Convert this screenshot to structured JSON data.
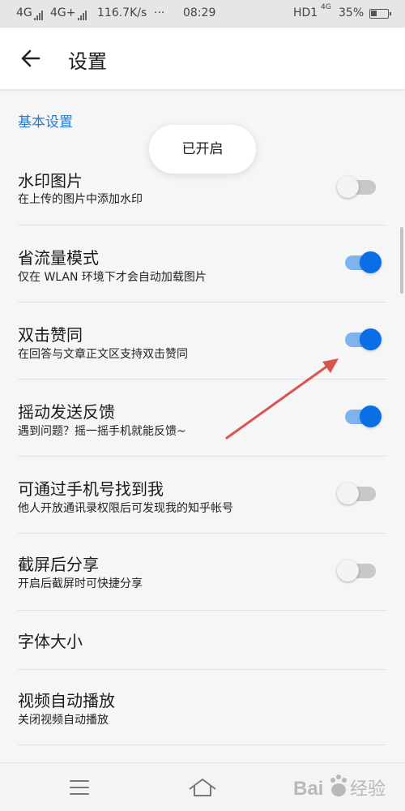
{
  "status_bar": {
    "network1": "4G",
    "network2": "4G+",
    "speed": "116.7K/s",
    "dots": "···",
    "time": "08:29",
    "hd": "HD1",
    "net_small": "4G",
    "battery": "35%"
  },
  "app_bar": {
    "title": "设置"
  },
  "section": {
    "basic": "基本设置"
  },
  "toast": "已开启",
  "settings": [
    {
      "title": "水印图片",
      "desc": "在上传的图片中添加水印",
      "on": false
    },
    {
      "title": "省流量模式",
      "desc": "仅在 WLAN 环境下才会自动加载图片",
      "on": true
    },
    {
      "title": "双击赞同",
      "desc": "在回答与文章正文区支持双击赞同",
      "on": true
    },
    {
      "title": "摇动发送反馈",
      "desc": "遇到问题？摇一摇手机就能反馈~",
      "on": true
    },
    {
      "title": "可通过手机号找到我",
      "desc": "他人开放通讯录权限后可发现我的知乎帐号",
      "on": false
    },
    {
      "title": "截屏后分享",
      "desc": "开启后截屏时可快捷分享",
      "on": false
    }
  ],
  "font_size": {
    "title": "字体大小"
  },
  "video": {
    "title": "视频自动播放",
    "desc": "关闭视频自动播放"
  },
  "colors": {
    "accent": "#1e7ad8",
    "toggle_on": "#0a6ee6",
    "arrow": "#d9534f"
  },
  "icons": {
    "back": "arrow-left-icon",
    "menu": "menu-icon",
    "home": "home-icon"
  },
  "watermark_text": "Baidu经验"
}
